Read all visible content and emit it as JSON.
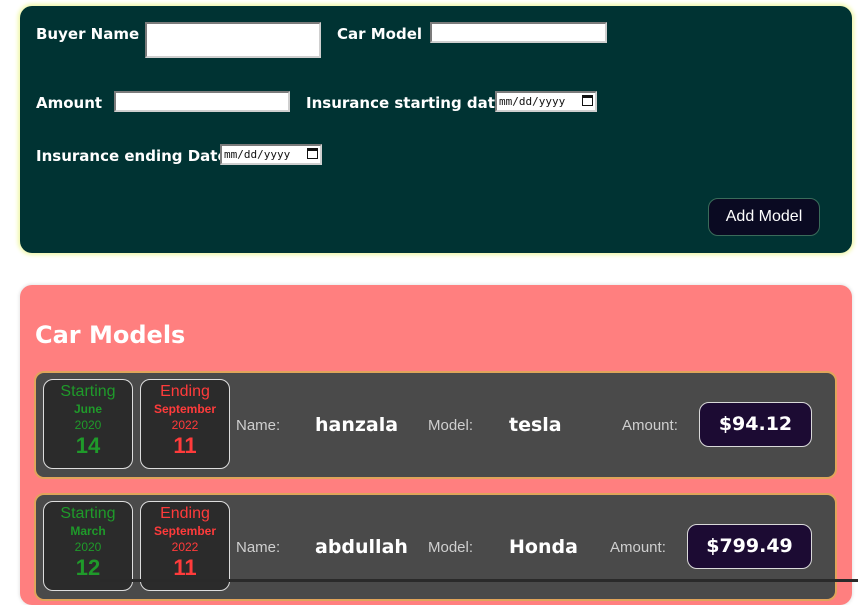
{
  "form": {
    "buyer_name_label": "Buyer Name",
    "buyer_name_value": "",
    "car_model_label": "Car Model",
    "car_model_value": "",
    "amount_label": "Amount",
    "amount_value": "",
    "start_label": "Insurance starting date",
    "start_placeholder": "mm/dd/yyyy",
    "end_label": "Insurance ending Date",
    "end_placeholder": "mm/dd/yyyy",
    "add_button": "Add Model"
  },
  "list": {
    "title": "Car Models",
    "name_key": "Name:",
    "model_key": "Model:",
    "amount_key": "Amount:",
    "start_word": "Starting",
    "end_word": "Ending",
    "items": [
      {
        "start": {
          "month": "June",
          "year": "2020",
          "day": "14"
        },
        "end": {
          "month": "September",
          "year": "2022",
          "day": "11"
        },
        "name": "hanzala",
        "model": "tesla",
        "amount": "$94.12"
      },
      {
        "start": {
          "month": "March",
          "year": "2020",
          "day": "12"
        },
        "end": {
          "month": "September",
          "year": "2022",
          "day": "11"
        },
        "name": "abdullah",
        "model": "Honda",
        "amount": "$799.49"
      }
    ]
  },
  "colors": {
    "form_bg": "#003333",
    "list_bg": "#ff7f7f",
    "card_bg": "#4a4a4a",
    "start_color": "#1f9a2a",
    "end_color": "#ff3b3b",
    "price_bg": "#1c0b33"
  }
}
